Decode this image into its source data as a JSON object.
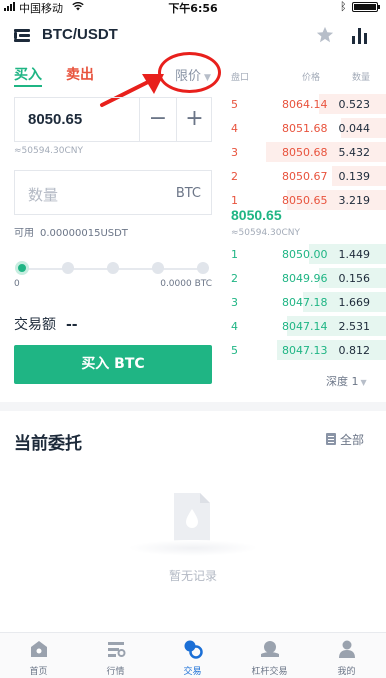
{
  "status_bar": {
    "carrier": "中国移动",
    "time": "下午6:56"
  },
  "header": {
    "pair": "BTC/USDT",
    "icons": [
      "menu-icon",
      "star-icon",
      "chart-icon"
    ]
  },
  "trade_tabs": {
    "buy_label": "买入",
    "sell_label": "卖出",
    "order_type": "限价"
  },
  "form": {
    "price_value": "8050.65",
    "price_cny": "≈50594.30CNY",
    "quantity_placeholder": "数量",
    "quantity_unit": "BTC",
    "available_label": "可用",
    "available_value": "0.00000015USDT",
    "slider_percent": 0,
    "slider_min_label": "0",
    "slider_max_label": "0.0000 BTC",
    "amount_label": "交易额",
    "amount_value": "--",
    "buy_button_label": "买入 BTC"
  },
  "order_book": {
    "headers": [
      "盘口",
      "价格",
      "数量"
    ],
    "asks": [
      {
        "level": "5",
        "price": "8064.14",
        "qty": "0.523",
        "depth": 0.42
      },
      {
        "level": "4",
        "price": "8051.68",
        "qty": "0.044",
        "depth": 0.28
      },
      {
        "level": "3",
        "price": "8050.68",
        "qty": "5.432",
        "depth": 0.75
      },
      {
        "level": "2",
        "price": "8050.67",
        "qty": "0.139",
        "depth": 0.34
      },
      {
        "level": "1",
        "price": "8050.65",
        "qty": "3.219",
        "depth": 0.62
      }
    ],
    "last_price": "8050.65",
    "last_price_cny": "≈50594.30CNY",
    "bids": [
      {
        "level": "1",
        "price": "8050.00",
        "qty": "1.449",
        "depth": 0.48
      },
      {
        "level": "2",
        "price": "8049.96",
        "qty": "0.156",
        "depth": 0.42
      },
      {
        "level": "3",
        "price": "8047.18",
        "qty": "1.669",
        "depth": 0.52
      },
      {
        "level": "4",
        "price": "8047.14",
        "qty": "2.531",
        "depth": 0.62
      },
      {
        "level": "5",
        "price": "8047.13",
        "qty": "0.812",
        "depth": 0.68
      }
    ],
    "depth_label": "深度 1"
  },
  "orders": {
    "title": "当前委托",
    "filter_label": "全部",
    "empty_text": "暂无记录"
  },
  "nav": [
    {
      "label": "首页",
      "icon": "home-icon"
    },
    {
      "label": "行情",
      "icon": "market-icon"
    },
    {
      "label": "交易",
      "icon": "trade-icon"
    },
    {
      "label": "杠杆交易",
      "icon": "margin-icon"
    },
    {
      "label": "我的",
      "icon": "profile-icon"
    }
  ],
  "colors": {
    "buy": "#1fb584",
    "sell": "#e8533d",
    "nav_active": "#1b6fd6",
    "annotation_red": "#e8201c"
  }
}
